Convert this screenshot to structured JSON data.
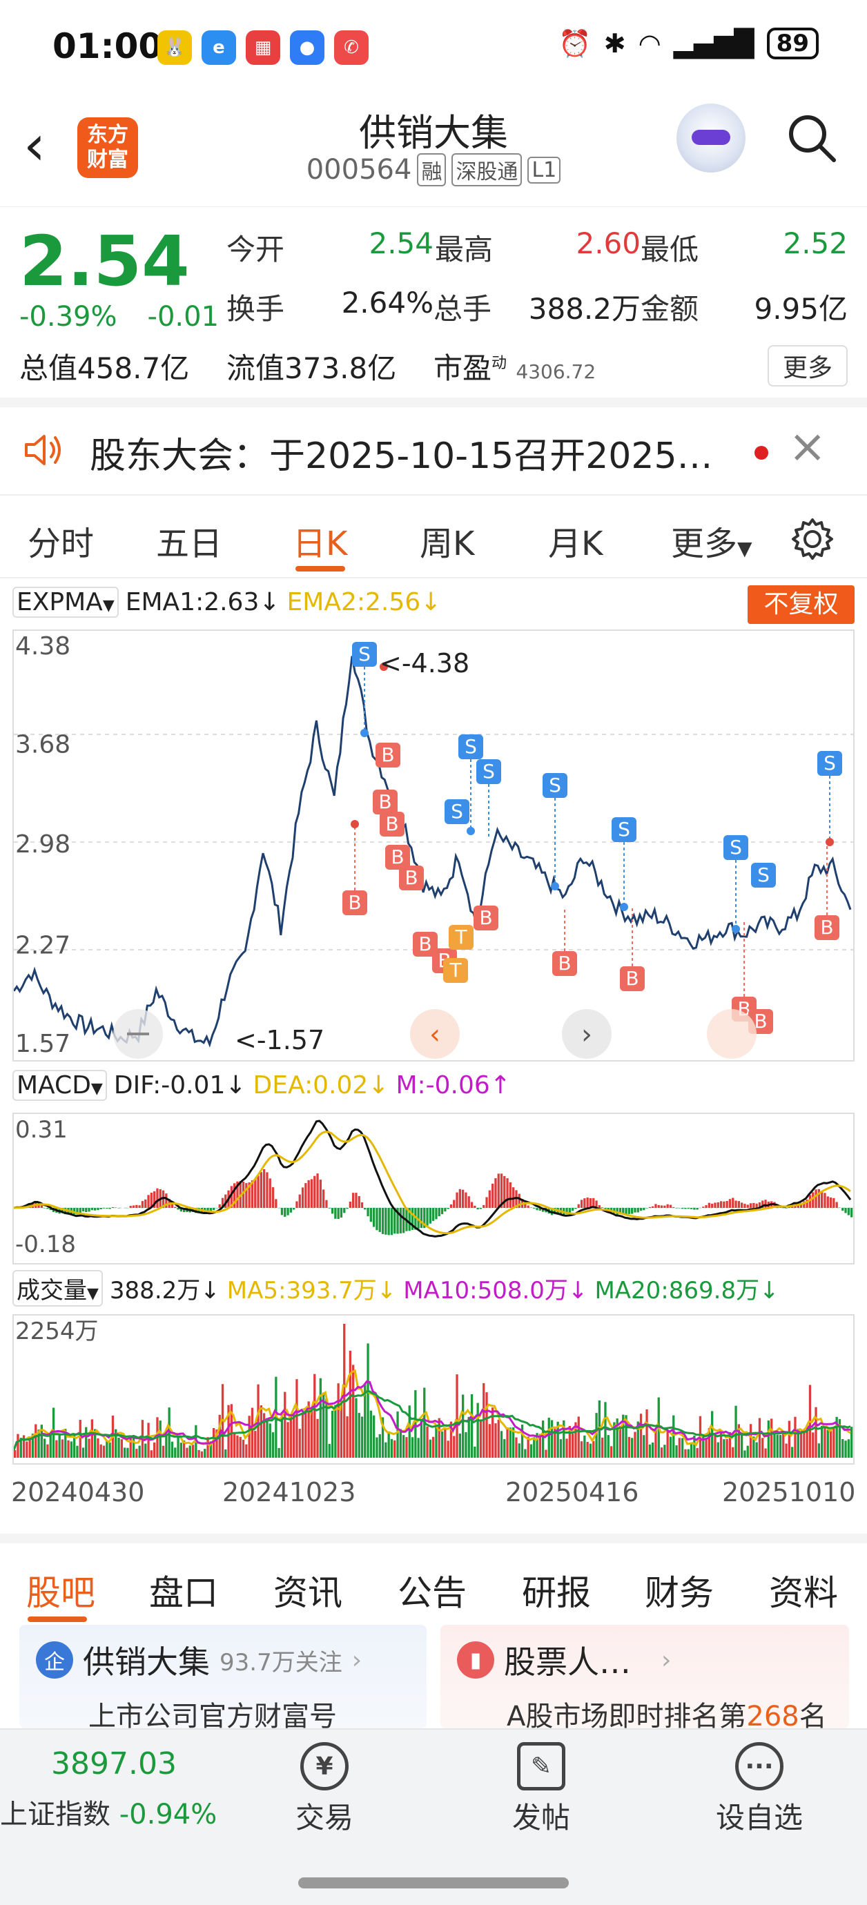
{
  "status_bar": {
    "time": "01:00",
    "battery": "89",
    "app_icons": [
      "bunny-app-icon",
      "browser-app-icon",
      "shopping-app-icon",
      "message-app-icon",
      "missed-call-icon"
    ]
  },
  "header": {
    "stock_name": "供销大集",
    "stock_code": "000564",
    "tags": [
      "融",
      "深股通",
      "L1"
    ],
    "logo_line1": "东方",
    "logo_line2": "财富"
  },
  "quote": {
    "price": "2.54",
    "change_pct": "-0.39%",
    "change_abs": "-0.01",
    "total_value": "总值458.7亿",
    "rows": [
      [
        {
          "label": "今开",
          "value": "2.54",
          "color": "green"
        },
        {
          "label": "最高",
          "value": "2.60",
          "color": "red"
        },
        {
          "label": "最低",
          "value": "2.52",
          "color": "green"
        }
      ],
      [
        {
          "label": "换手",
          "value": "2.64%",
          "color": "black"
        },
        {
          "label": "总手",
          "value": "388.2万",
          "color": "black"
        },
        {
          "label": "金额",
          "value": "9.95亿",
          "color": "black"
        }
      ]
    ],
    "float_value": "流值373.8亿",
    "pe_label": "市盈",
    "pe_sup": "动",
    "pe_value": "4306.72",
    "more_label": "更多"
  },
  "notice": {
    "text": "股东大会：于2025-10-15召开2025…"
  },
  "kline_tabs": {
    "items": [
      "分时",
      "五日",
      "日K",
      "周K",
      "月K",
      "更多"
    ],
    "active": "日K"
  },
  "expma": {
    "select": "EXPMA",
    "ema1": "EMA1:2.63",
    "ema2": "EMA2:2.56",
    "adjust_button": "不复权",
    "y_labels": [
      "4.38",
      "3.68",
      "2.98",
      "2.27",
      "1.57"
    ],
    "high_label": "<-4.38",
    "low_label": "<-1.57"
  },
  "macd": {
    "select": "MACD",
    "dif": "DIF:-0.01",
    "dea": "DEA:0.02",
    "m": "M:-0.06",
    "y_labels": [
      "0.31",
      "-0.18"
    ]
  },
  "volume": {
    "select": "成交量",
    "total": "388.2万",
    "ma5": "MA5:393.7万",
    "ma10": "MA10:508.0万",
    "ma20": "MA20:869.8万",
    "y_top": "2254万",
    "x_labels": [
      "20240430",
      "20241023",
      "20250416",
      "20251010"
    ]
  },
  "bottom_tabs": {
    "items": [
      "股吧",
      "盘口",
      "资讯",
      "公告",
      "研报",
      "财务",
      "资料"
    ],
    "active": "股吧"
  },
  "cards": {
    "left_title": "供销大集",
    "left_follow": "93.7万关注",
    "left_sub": "上市公司官方财富号",
    "right_title": "股票人…",
    "right_sub_prefix": "A股市场即时排名第",
    "right_sub_rank": "268",
    "right_sub_suffix": "名"
  },
  "bottom_nav": {
    "index_value": "3897.03",
    "index_name": "上证指数",
    "index_change": "-0.94%",
    "items": [
      "交易",
      "发帖",
      "设自选"
    ]
  },
  "colors": {
    "accent": "#e8601c",
    "down_green": "#1a9a3c",
    "up_red": "#e03b3b",
    "ema2_yellow": "#e5b800",
    "price_line": "#1f3f6e"
  },
  "chart_data": [
    {
      "type": "line",
      "name": "EXPMA daily K",
      "x": [
        "20240430",
        "20241023",
        "20250416",
        "20251010"
      ],
      "ylim": [
        1.57,
        4.38
      ],
      "y_ticks": [
        4.38,
        3.68,
        2.98,
        2.27,
        1.57
      ],
      "series": [
        {
          "values": [
            1.95,
            2.08,
            1.9,
            1.78,
            1.7,
            1.68,
            1.62,
            1.65,
            1.95,
            1.75,
            1.62,
            1.58,
            2.0,
            2.2,
            2.95,
            2.4,
            3.2,
            3.8,
            3.3,
            4.35,
            3.7,
            3.4,
            3.1,
            2.7,
            2.6,
            2.9,
            2.4,
            3.05,
            2.95,
            2.85,
            2.72,
            2.6,
            2.9,
            2.7,
            2.52,
            2.45,
            2.48,
            2.4,
            2.3,
            2.32,
            2.4,
            2.35,
            2.42,
            2.4,
            2.48,
            2.8,
            2.82,
            2.52
          ]
        }
      ],
      "annotations": [
        "<-4.38",
        "<-1.57"
      ]
    },
    {
      "type": "bar",
      "name": "MACD",
      "ylim": [
        -0.18,
        0.31
      ],
      "series": [
        {
          "name": "DIF",
          "value_last": -0.01
        },
        {
          "name": "DEA",
          "value_last": 0.02
        },
        {
          "name": "M",
          "value_last": -0.06
        }
      ]
    },
    {
      "type": "bar",
      "name": "成交量",
      "x": [
        "20240430",
        "20241023",
        "20250416",
        "20251010"
      ],
      "ylim": [
        0,
        2254
      ],
      "series": [
        {
          "name": "MA5",
          "value_last": 393.7
        },
        {
          "name": "MA10",
          "value_last": 508.0
        },
        {
          "name": "MA20",
          "value_last": 869.8
        }
      ]
    }
  ]
}
